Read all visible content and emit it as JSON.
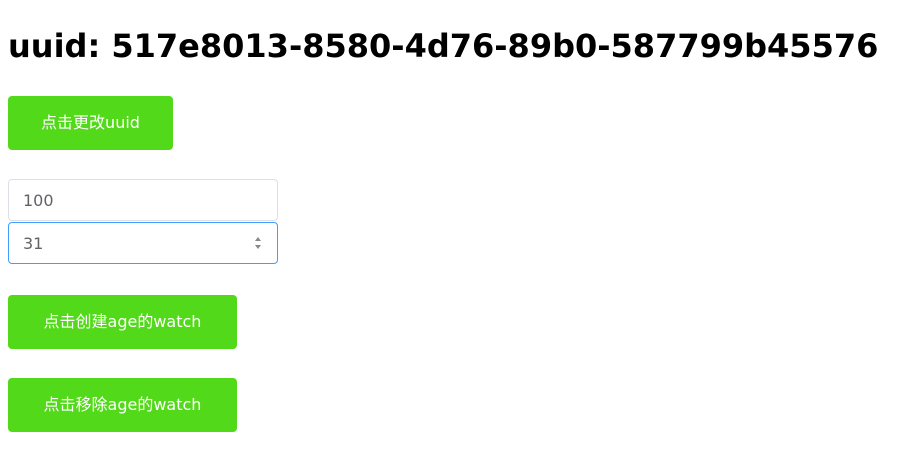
{
  "header": {
    "uuid_text": "uuid: 517e8013-8580-4d76-89b0-587799b45576"
  },
  "buttons": {
    "change_uuid": "点击更改uuid",
    "create_watch": "点击创建age的watch",
    "remove_watch": "点击移除age的watch"
  },
  "inputs": {
    "text_value": "100",
    "age_value": "31"
  },
  "colors": {
    "button_bg": "#52d91a",
    "focus_border": "#409eff"
  },
  "icons": {
    "spinner_up": "caret-up-icon",
    "spinner_down": "caret-down-icon"
  }
}
